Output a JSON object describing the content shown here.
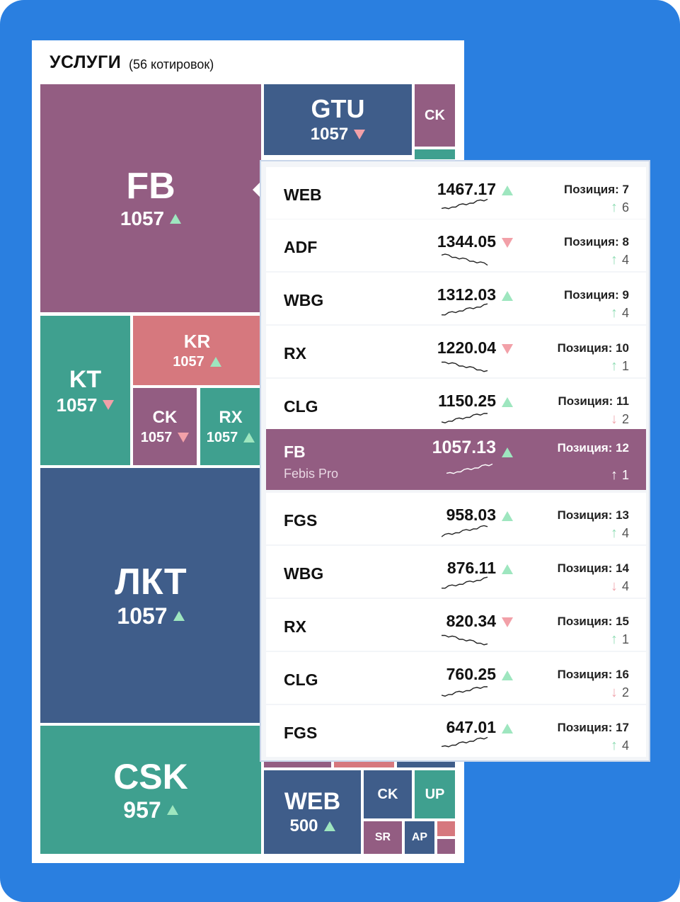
{
  "header": {
    "title": "УСЛУГИ",
    "count": "(56 котировок)"
  },
  "tiles": [
    {
      "ticker": "FB",
      "value": "1057",
      "dir": "up",
      "color": "purple"
    },
    {
      "ticker": "GTU",
      "value": "1057",
      "dir": "down",
      "color": "blue"
    },
    {
      "ticker": "CK",
      "value": "",
      "dir": "",
      "color": "purple"
    },
    {
      "ticker": "KT",
      "value": "1057",
      "dir": "down",
      "color": "teal"
    },
    {
      "ticker": "KR",
      "value": "1057",
      "dir": "up",
      "color": "pink"
    },
    {
      "ticker": "CK",
      "value": "1057",
      "dir": "down",
      "color": "purple"
    },
    {
      "ticker": "RX",
      "value": "1057",
      "dir": "up",
      "color": "teal"
    },
    {
      "ticker": "ЛКТ",
      "value": "1057",
      "dir": "up",
      "color": "blue"
    },
    {
      "ticker": "CSK",
      "value": "957",
      "dir": "up",
      "color": "teal"
    },
    {
      "ticker": "WEB",
      "value": "500",
      "dir": "up",
      "color": "blue"
    },
    {
      "ticker": "CK",
      "value": "",
      "dir": "",
      "color": "blue"
    },
    {
      "ticker": "UP",
      "value": "",
      "dir": "",
      "color": "teal"
    },
    {
      "ticker": "SR",
      "value": "",
      "dir": "",
      "color": "purple"
    },
    {
      "ticker": "AP",
      "value": "",
      "dir": "",
      "color": "blue"
    }
  ],
  "popup": {
    "rows": [
      {
        "symbol": "WEB",
        "price": "1467.17",
        "dir": "up",
        "position": "Позиция: 7",
        "change": "6",
        "change_dir": "up"
      },
      {
        "symbol": "ADF",
        "price": "1344.05",
        "dir": "down",
        "position": "Позиция: 8",
        "change": "4",
        "change_dir": "up"
      },
      {
        "symbol": "WBG",
        "price": "1312.03",
        "dir": "up",
        "position": "Позиция: 9",
        "change": "4",
        "change_dir": "up"
      },
      {
        "symbol": "RX",
        "price": "1220.04",
        "dir": "down",
        "position": "Позиция: 10",
        "change": "1",
        "change_dir": "up"
      },
      {
        "symbol": "CLG",
        "price": "1150.25",
        "dir": "up",
        "position": "Позиция: 11",
        "change": "2",
        "change_dir": "down"
      },
      {
        "symbol": "FB",
        "subtitle": "Febis Pro",
        "price": "1057.13",
        "dir": "up",
        "position": "Позиция: 12",
        "change": "1",
        "change_dir": "up",
        "selected": true
      },
      {
        "symbol": "FGS",
        "price": "958.03",
        "dir": "up",
        "position": "Позиция: 13",
        "change": "4",
        "change_dir": "up"
      },
      {
        "symbol": "WBG",
        "price": "876.11",
        "dir": "up",
        "position": "Позиция: 14",
        "change": "4",
        "change_dir": "down"
      },
      {
        "symbol": "RX",
        "price": "820.34",
        "dir": "down",
        "position": "Позиция: 15",
        "change": "1",
        "change_dir": "up"
      },
      {
        "symbol": "CLG",
        "price": "760.25",
        "dir": "up",
        "position": "Позиция: 16",
        "change": "2",
        "change_dir": "down"
      },
      {
        "symbol": "FGS",
        "price": "647.01",
        "dir": "up",
        "position": "Позиция: 17",
        "change": "4",
        "change_dir": "up"
      }
    ]
  },
  "colors": {
    "background": "#2a7fe0",
    "purple": "#935d82",
    "blue": "#3f5d8a",
    "teal": "#3fa08f",
    "pink": "#d6787e",
    "up": "#9ee6bf",
    "down": "#f2a0a8"
  }
}
